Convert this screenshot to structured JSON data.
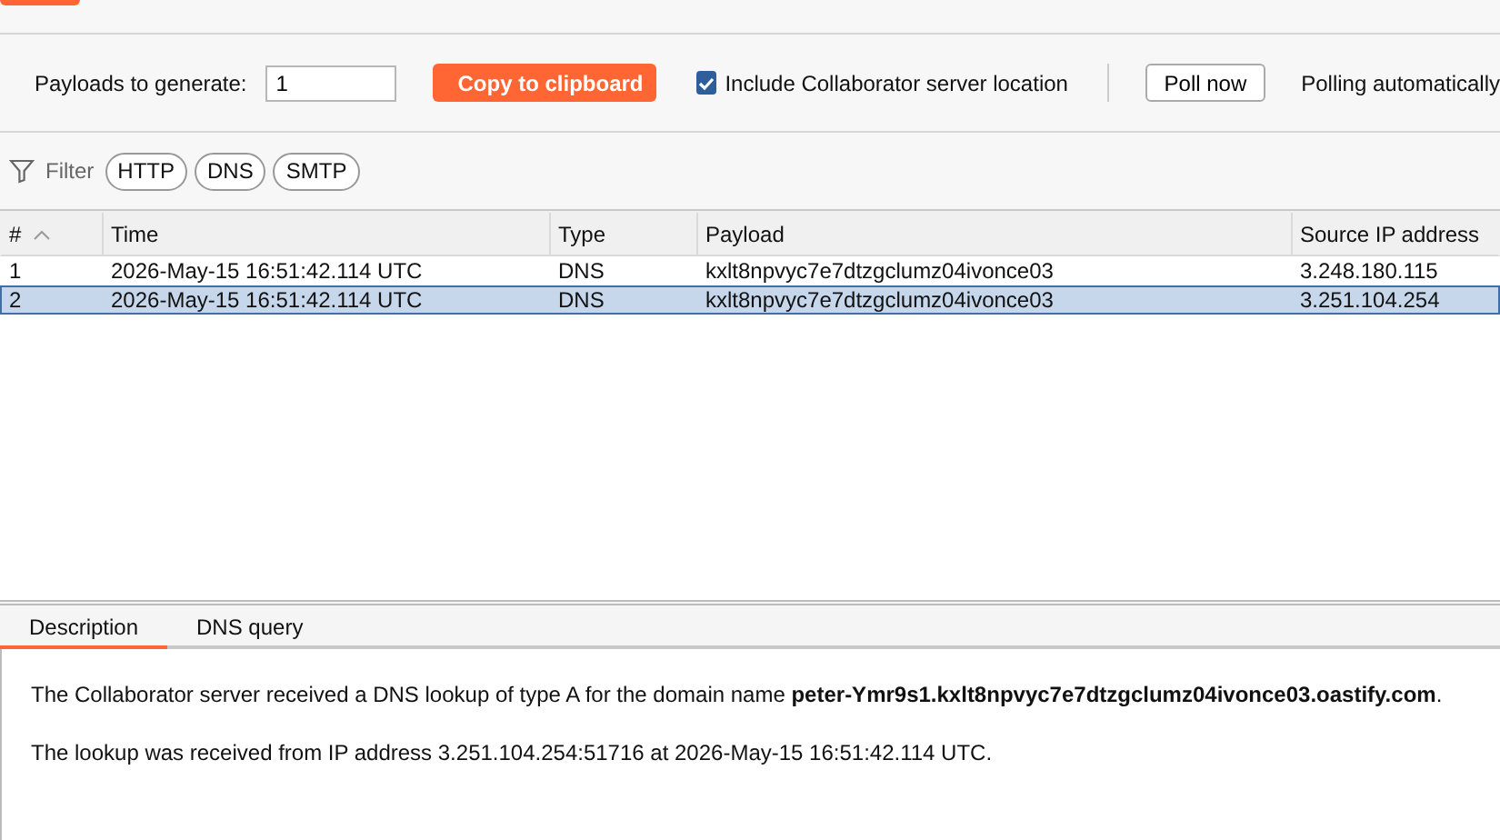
{
  "toolbar": {
    "payloads_label": "Payloads to generate:",
    "payloads_value": "1",
    "copy_button": "Copy to clipboard",
    "include_option": {
      "label": "Include Collaborator server location",
      "checked": true
    },
    "poll_button": "Poll now",
    "polling_status": "Polling automatically"
  },
  "filter": {
    "label": "Filter",
    "chips": [
      "HTTP",
      "DNS",
      "SMTP"
    ]
  },
  "table": {
    "columns": [
      {
        "label": "#",
        "sorted": true
      },
      {
        "label": "Time",
        "sorted": false
      },
      {
        "label": "Type",
        "sorted": false
      },
      {
        "label": "Payload",
        "sorted": false
      },
      {
        "label": "Source IP address",
        "sorted": false
      }
    ],
    "rows": [
      {
        "cells": [
          "1",
          "2026-May-15 16:51:42.114 UTC",
          "DNS",
          "kxlt8npvyc7e7dtzgclumz04ivonce03",
          "3.248.180.115"
        ],
        "selected": false
      },
      {
        "cells": [
          "2",
          "2026-May-15 16:51:42.114 UTC",
          "DNS",
          "kxlt8npvyc7e7dtzgclumz04ivonce03",
          "3.251.104.254"
        ],
        "selected": true
      }
    ]
  },
  "detail": {
    "tabs": [
      {
        "label": "Description",
        "selected": true
      },
      {
        "label": "DNS query",
        "selected": false
      }
    ],
    "paragraphs": [
      "The Collaborator server received a DNS lookup of type A for the domain name **peter-Ymr9s1.kxlt8npvyc7e7dtzgclumz04ivonce03.oastify.com**.",
      "The lookup was received from IP address 3.251.104.254:51716 at 2026-May-15 16:51:42.114 UTC."
    ]
  }
}
